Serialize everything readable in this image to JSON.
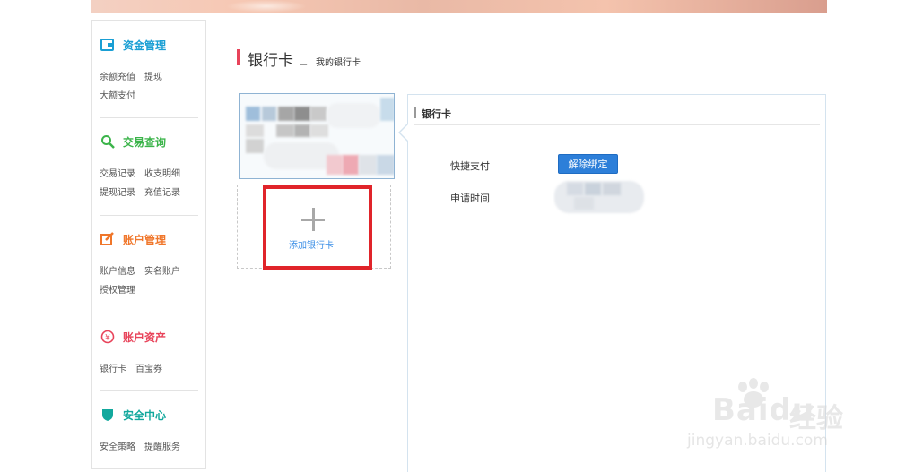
{
  "sidebar": {
    "sections": [
      {
        "title": "资金管理",
        "icon": "wallet-icon",
        "color": "#1a9fd4",
        "links": [
          "余额充值",
          "提现",
          "大额支付"
        ]
      },
      {
        "title": "交易查询",
        "icon": "search-icon",
        "color": "#3bb44a",
        "links": [
          "交易记录",
          "收支明细",
          "提现记录",
          "充值记录"
        ]
      },
      {
        "title": "账户管理",
        "icon": "edit-icon",
        "color": "#f0762a",
        "links": [
          "账户信息",
          "实名账户",
          "授权管理"
        ]
      },
      {
        "title": "账户资产",
        "icon": "yuan-circle-icon",
        "color": "#e8435a",
        "links": [
          "银行卡",
          "百宝券"
        ]
      },
      {
        "title": "安全中心",
        "icon": "shield-icon",
        "color": "#12a89d",
        "links": [
          "安全策略",
          "提醒服务"
        ]
      }
    ]
  },
  "header": {
    "title": "银行卡",
    "separator": "_",
    "subtitle": "我的银行卡"
  },
  "cards": {
    "add_label": "添加银行卡"
  },
  "detail": {
    "heading": "银行卡",
    "quick_pay_label": "快捷支付",
    "unbind_button": "解除绑定",
    "apply_time_label": "申请时间"
  },
  "watermark": {
    "brand": "Bai",
    "brand_du": "du",
    "cn": "经验",
    "url": "jingyan.baidu.com"
  },
  "colors": {
    "accent": "#e8435a",
    "highlight": "#e0242a",
    "button": "#2d7fd9",
    "link_blue": "#3a8ee6"
  }
}
